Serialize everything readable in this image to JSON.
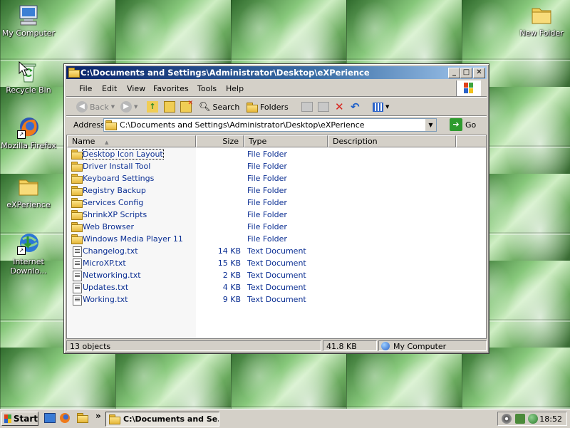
{
  "desktop": {
    "icons": [
      {
        "label": "My Computer",
        "icon": "computer-icon"
      },
      {
        "label": "Recycle Bin",
        "icon": "recycle-bin-icon"
      },
      {
        "label": "Mozilla Firefox",
        "icon": "firefox-icon"
      },
      {
        "label": "eXPerience",
        "icon": "folder-icon"
      },
      {
        "label": "Internet\nDownlo...",
        "icon": "internet-download-icon"
      },
      {
        "label": "New Folder",
        "icon": "folder-icon"
      }
    ]
  },
  "window": {
    "title": "C:\\Documents and Settings\\Administrator\\Desktop\\eXPerience",
    "menu": [
      "File",
      "Edit",
      "View",
      "Favorites",
      "Tools",
      "Help"
    ],
    "toolbar": {
      "back": "Back",
      "search": "Search",
      "folders": "Folders"
    },
    "address": {
      "label": "Address",
      "value": "C:\\Documents and Settings\\Administrator\\Desktop\\eXPerience",
      "go": "Go"
    },
    "columns": {
      "name": "Name",
      "size": "Size",
      "type": "Type",
      "description": "Description"
    },
    "files": [
      {
        "name": "Desktop Icon Layout",
        "size": "",
        "type": "File Folder",
        "kind": "folder"
      },
      {
        "name": "Driver Install Tool",
        "size": "",
        "type": "File Folder",
        "kind": "folder"
      },
      {
        "name": "Keyboard Settings",
        "size": "",
        "type": "File Folder",
        "kind": "folder"
      },
      {
        "name": "Registry Backup",
        "size": "",
        "type": "File Folder",
        "kind": "folder"
      },
      {
        "name": "Services Config",
        "size": "",
        "type": "File Folder",
        "kind": "folder"
      },
      {
        "name": "ShrinkXP Scripts",
        "size": "",
        "type": "File Folder",
        "kind": "folder"
      },
      {
        "name": "Web Browser",
        "size": "",
        "type": "File Folder",
        "kind": "folder"
      },
      {
        "name": "Windows Media Player 11",
        "size": "",
        "type": "File Folder",
        "kind": "folder"
      },
      {
        "name": "Changelog.txt",
        "size": "14 KB",
        "type": "Text Document",
        "kind": "text"
      },
      {
        "name": "MicroXP.txt",
        "size": "15 KB",
        "type": "Text Document",
        "kind": "text"
      },
      {
        "name": "Networking.txt",
        "size": "2 KB",
        "type": "Text Document",
        "kind": "text"
      },
      {
        "name": "Updates.txt",
        "size": "4 KB",
        "type": "Text Document",
        "kind": "text"
      },
      {
        "name": "Working.txt",
        "size": "9 KB",
        "type": "Text Document",
        "kind": "text"
      }
    ],
    "status": {
      "objects": "13 objects",
      "size": "41.8 KB",
      "location": "My Computer"
    }
  },
  "taskbar": {
    "start": "Start",
    "task": "C:\\Documents and Se...",
    "clock": "18:52",
    "chevron": "»"
  },
  "colors": {
    "title_start": "#0a246a",
    "title_end": "#a6caf0",
    "link_text": "#0b2f93",
    "chrome": "#d4d0c8"
  }
}
